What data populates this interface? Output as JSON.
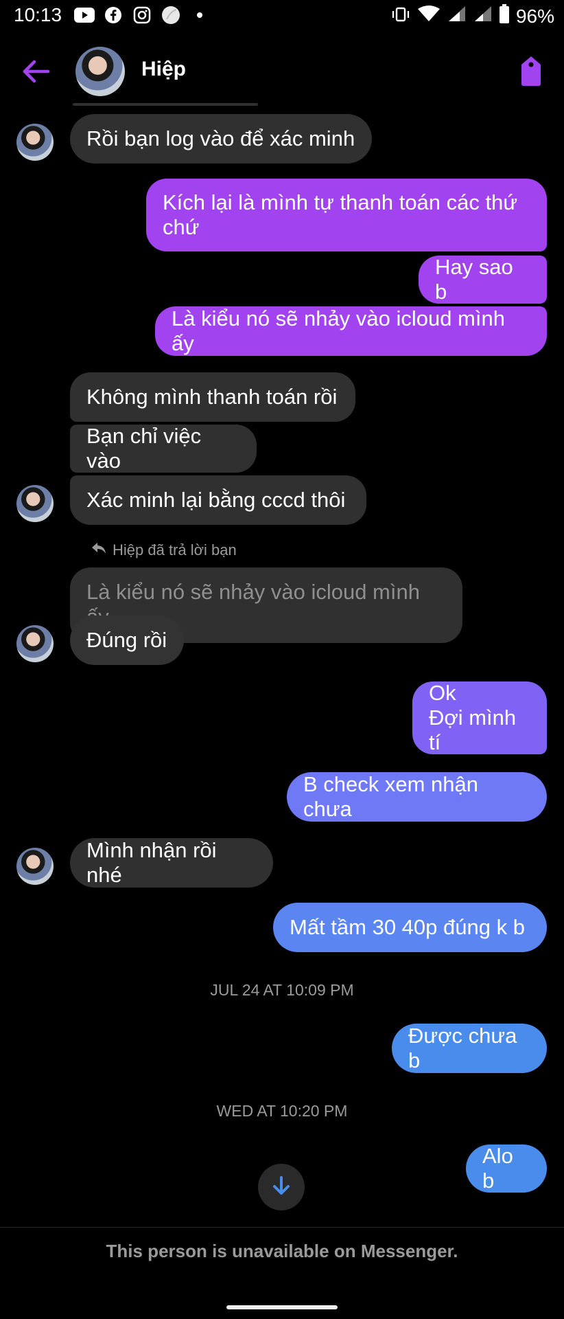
{
  "status_bar": {
    "time": "10:13",
    "battery": "96%"
  },
  "header": {
    "contact_name": "Hiệp"
  },
  "messages": [
    {
      "text": "Rồi bạn log vào để xác minh",
      "dir": "in"
    },
    {
      "text": "Kích lại là mình tự thanh toán các thứ chứ",
      "dir": "out"
    },
    {
      "text": "Hay sao b",
      "dir": "out"
    },
    {
      "text": "Là kiểu nó sẽ nhảy vào icloud mình ấy",
      "dir": "out"
    },
    {
      "text": "Không mình thanh toán rồi",
      "dir": "in"
    },
    {
      "text": "Bạn chỉ việc vào",
      "dir": "in"
    },
    {
      "text": "Xác minh lại bằng cccd thôi",
      "dir": "in"
    },
    {
      "text": "Đúng rồi",
      "dir": "in"
    },
    {
      "text": "Ok\nĐợi mình tí",
      "dir": "out"
    },
    {
      "text": "B check xem nhận chưa",
      "dir": "out"
    },
    {
      "text": "Mình nhận rồi nhé",
      "dir": "in"
    },
    {
      "text": "Mất tầm 30 40p đúng k b",
      "dir": "out"
    },
    {
      "text": "Được chưa b",
      "dir": "out"
    },
    {
      "text": "Alo b",
      "dir": "out"
    }
  ],
  "reply": {
    "label": "Hiệp đã trả lời bạn",
    "quoted_text": "Là kiểu nó sẽ nhảy vào icloud mình ấy"
  },
  "timestamps": [
    "JUL 24 AT 10:09 PM",
    "WED AT 10:20 PM"
  ],
  "footer": {
    "unavailable_text": "This person is unavailable on Messenger."
  },
  "colors": {
    "accent_purple": "#a243f0",
    "incoming_bubble": "#303030",
    "outgoing_blue": "#4a8cec"
  }
}
